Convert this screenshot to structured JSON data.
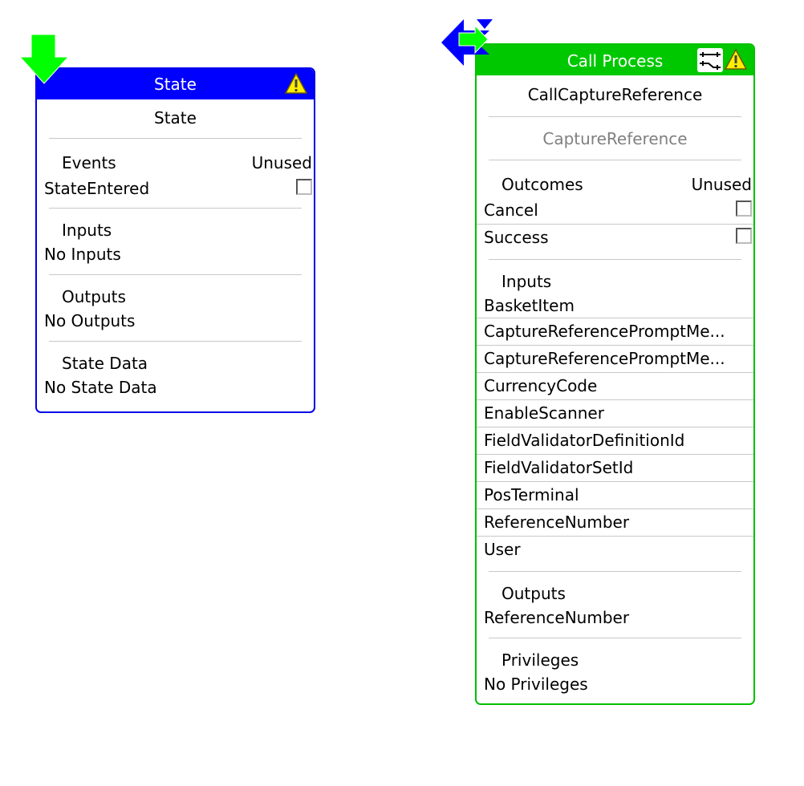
{
  "state_node": {
    "header_title": "State",
    "header_color": "#0000ff",
    "icons": [
      "entry-down-arrow-icon",
      "warning-icon"
    ],
    "name": "State",
    "events": {
      "label": "Events",
      "unused_label": "Unused",
      "items": [
        {
          "label": "StateEntered",
          "unused": false
        }
      ]
    },
    "inputs": {
      "label": "Inputs",
      "items": [
        "No Inputs"
      ]
    },
    "outputs": {
      "label": "Outputs",
      "items": [
        "No Outputs"
      ]
    },
    "state_data": {
      "label": "State Data",
      "items": [
        "No State Data"
      ]
    }
  },
  "call_node": {
    "header_title": "Call Process",
    "header_color": "#00c800",
    "icons": [
      "call-arrows-icon",
      "routing-icon",
      "warning-icon"
    ],
    "name": "CallCaptureReference",
    "process": "CaptureReference",
    "outcomes": {
      "label": "Outcomes",
      "unused_label": "Unused",
      "items": [
        {
          "label": "Cancel",
          "unused": false
        },
        {
          "label": "Success",
          "unused": false
        }
      ]
    },
    "inputs": {
      "label": "Inputs",
      "items": [
        "BasketItem",
        "CaptureReferencePromptMe...",
        "CaptureReferencePromptMe...",
        "CurrencyCode",
        "EnableScanner",
        "FieldValidatorDefinitionId",
        "FieldValidatorSetId",
        "PosTerminal",
        "ReferenceNumber",
        "User"
      ]
    },
    "outputs": {
      "label": "Outputs",
      "items": [
        "ReferenceNumber"
      ]
    },
    "privileges": {
      "label": "Privileges",
      "items": [
        "No Privileges"
      ]
    }
  }
}
